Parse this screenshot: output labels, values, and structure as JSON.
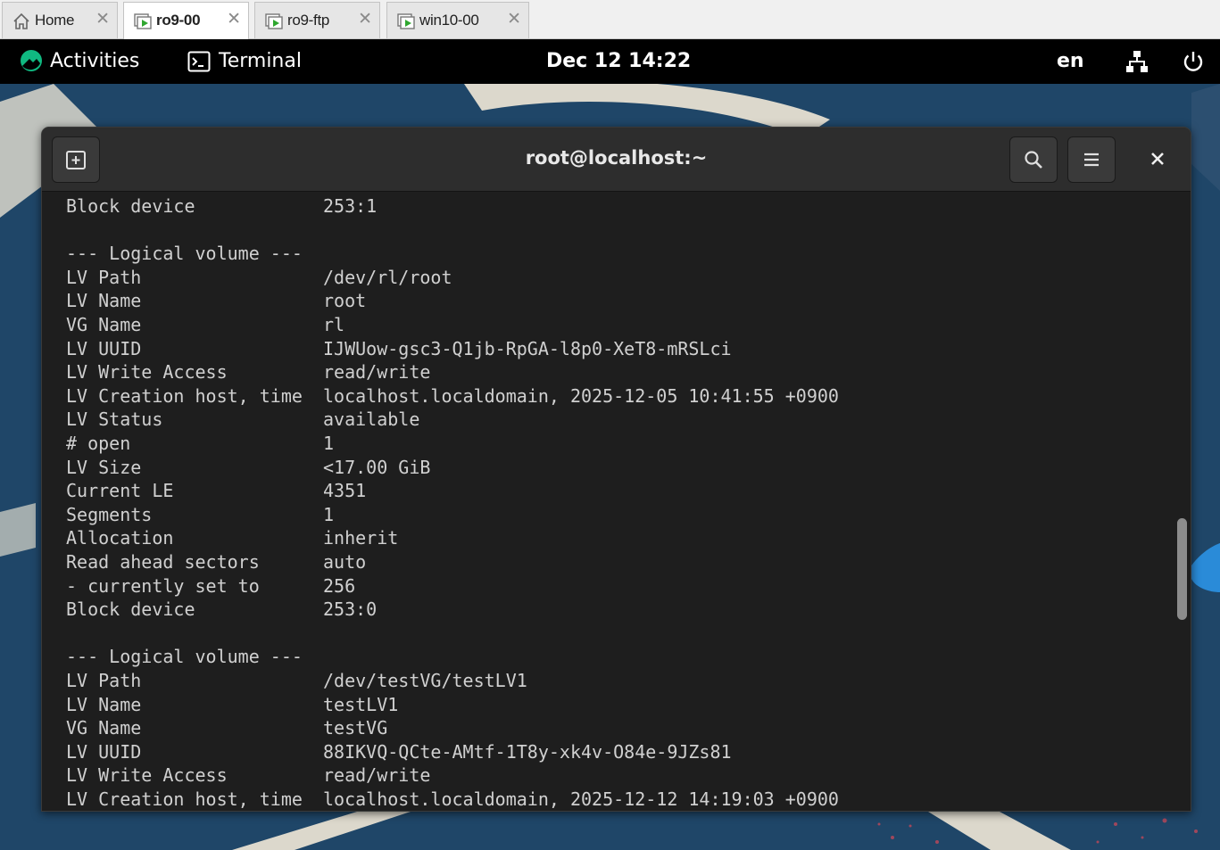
{
  "vm_tabs": [
    {
      "label": "Home",
      "icon": "home-icon",
      "active": false
    },
    {
      "label": "ro9-00",
      "icon": "vm-icon",
      "active": true
    },
    {
      "label": "ro9-ftp",
      "icon": "vm-icon",
      "active": false
    },
    {
      "label": "win10-00",
      "icon": "vm-icon",
      "active": false
    }
  ],
  "topbar": {
    "activities": "Activities",
    "app_name": "Terminal",
    "clock": "Dec 12  14:22",
    "lang": "en"
  },
  "window": {
    "title": "root@localhost:~"
  },
  "terminal_lines": [
    {
      "key": "Block device",
      "value": "253:1"
    },
    {
      "key": "",
      "value": ""
    },
    {
      "key": "--- Logical volume ---",
      "value": ""
    },
    {
      "key": "LV Path",
      "value": "/dev/rl/root"
    },
    {
      "key": "LV Name",
      "value": "root"
    },
    {
      "key": "VG Name",
      "value": "rl"
    },
    {
      "key": "LV UUID",
      "value": "IJWUow-gsc3-Q1jb-RpGA-l8p0-XeT8-mRSLci"
    },
    {
      "key": "LV Write Access",
      "value": "read/write"
    },
    {
      "key": "LV Creation host, time",
      "value": "localhost.localdomain, 2025-12-05 10:41:55 +0900"
    },
    {
      "key": "LV Status",
      "value": "available"
    },
    {
      "key": "# open",
      "value": "1"
    },
    {
      "key": "LV Size",
      "value": "<17.00 GiB"
    },
    {
      "key": "Current LE",
      "value": "4351"
    },
    {
      "key": "Segments",
      "value": "1"
    },
    {
      "key": "Allocation",
      "value": "inherit"
    },
    {
      "key": "Read ahead sectors",
      "value": "auto"
    },
    {
      "key": "- currently set to",
      "value": "256"
    },
    {
      "key": "Block device",
      "value": "253:0"
    },
    {
      "key": "",
      "value": ""
    },
    {
      "key": "--- Logical volume ---",
      "value": ""
    },
    {
      "key": "LV Path",
      "value": "/dev/testVG/testLV1"
    },
    {
      "key": "LV Name",
      "value": "testLV1"
    },
    {
      "key": "VG Name",
      "value": "testVG"
    },
    {
      "key": "LV UUID",
      "value": "88IKVQ-QCte-AMtf-1T8y-xk4v-O84e-9JZs81"
    },
    {
      "key": "LV Write Access",
      "value": "read/write"
    },
    {
      "key": "LV Creation host, time",
      "value": "localhost.localdomain, 2025-12-12 14:19:03 +0900"
    }
  ],
  "colors": {
    "terminal_bg": "#1e1e1e",
    "terminal_fg": "#d0d0d0",
    "topbar_bg": "#000000",
    "desktop_bg": "#1f4668"
  }
}
